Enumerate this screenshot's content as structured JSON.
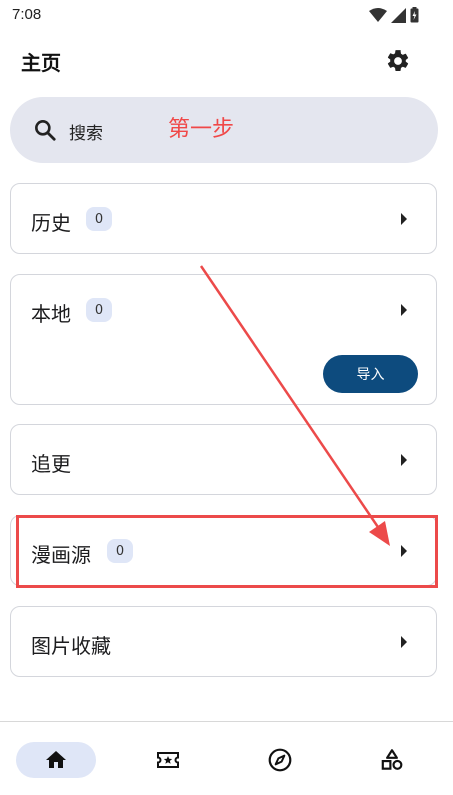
{
  "status": {
    "time": "7:08"
  },
  "header": {
    "title": "主页"
  },
  "search": {
    "placeholder": "搜索"
  },
  "annotation": {
    "step_label": "第一步"
  },
  "cards": [
    {
      "label": "历史",
      "badge": "0"
    },
    {
      "label": "本地",
      "badge": "0",
      "button": "导入"
    },
    {
      "label": "追更"
    },
    {
      "label": "漫画源",
      "badge": "0"
    },
    {
      "label": "图片收藏"
    }
  ],
  "bottom_nav": [
    {
      "icon": "home-icon",
      "active": true
    },
    {
      "icon": "ticket-icon",
      "active": false
    },
    {
      "icon": "compass-icon",
      "active": false
    },
    {
      "icon": "categories-icon",
      "active": false
    }
  ],
  "colors": {
    "accent": "#0d4b7e",
    "annotation": "#ec4a4a",
    "badge_bg": "#dfe6f7",
    "search_bg": "#e4e6ef"
  }
}
